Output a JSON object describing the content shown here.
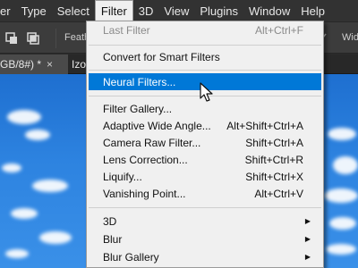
{
  "menubar": {
    "items": [
      "er",
      "Type",
      "Select",
      "Filter",
      "3D",
      "View",
      "Plugins",
      "Window",
      "Help"
    ]
  },
  "options": {
    "feather_label": "Feath",
    "width_label": "Widt"
  },
  "tabs": {
    "active": "GB/8#) *",
    "active_close": "×",
    "second": "Izo"
  },
  "filter_menu": {
    "last_filter": {
      "label": "Last Filter",
      "shortcut": "Alt+Ctrl+F"
    },
    "convert_smart": {
      "label": "Convert for Smart Filters"
    },
    "neural_filters": {
      "label": "Neural Filters..."
    },
    "filter_gallery": {
      "label": "Filter Gallery..."
    },
    "adaptive_wide_angle": {
      "label": "Adaptive Wide Angle...",
      "shortcut": "Alt+Shift+Ctrl+A"
    },
    "camera_raw": {
      "label": "Camera Raw Filter...",
      "shortcut": "Shift+Ctrl+A"
    },
    "lens_correction": {
      "label": "Lens Correction...",
      "shortcut": "Shift+Ctrl+R"
    },
    "liquify": {
      "label": "Liquify...",
      "shortcut": "Shift+Ctrl+X"
    },
    "vanishing_point": {
      "label": "Vanishing Point...",
      "shortcut": "Alt+Ctrl+V"
    },
    "3d": {
      "label": "3D"
    },
    "blur": {
      "label": "Blur"
    },
    "blur_gallery": {
      "label": "Blur Gallery"
    }
  },
  "colors": {
    "menu_highlight": "#0078d7",
    "menubar_bg": "#323232",
    "sky": "#2d83e0"
  },
  "icons": {
    "submenu": "chevron-right-icon",
    "cursor": "mouse-pointer-icon"
  }
}
